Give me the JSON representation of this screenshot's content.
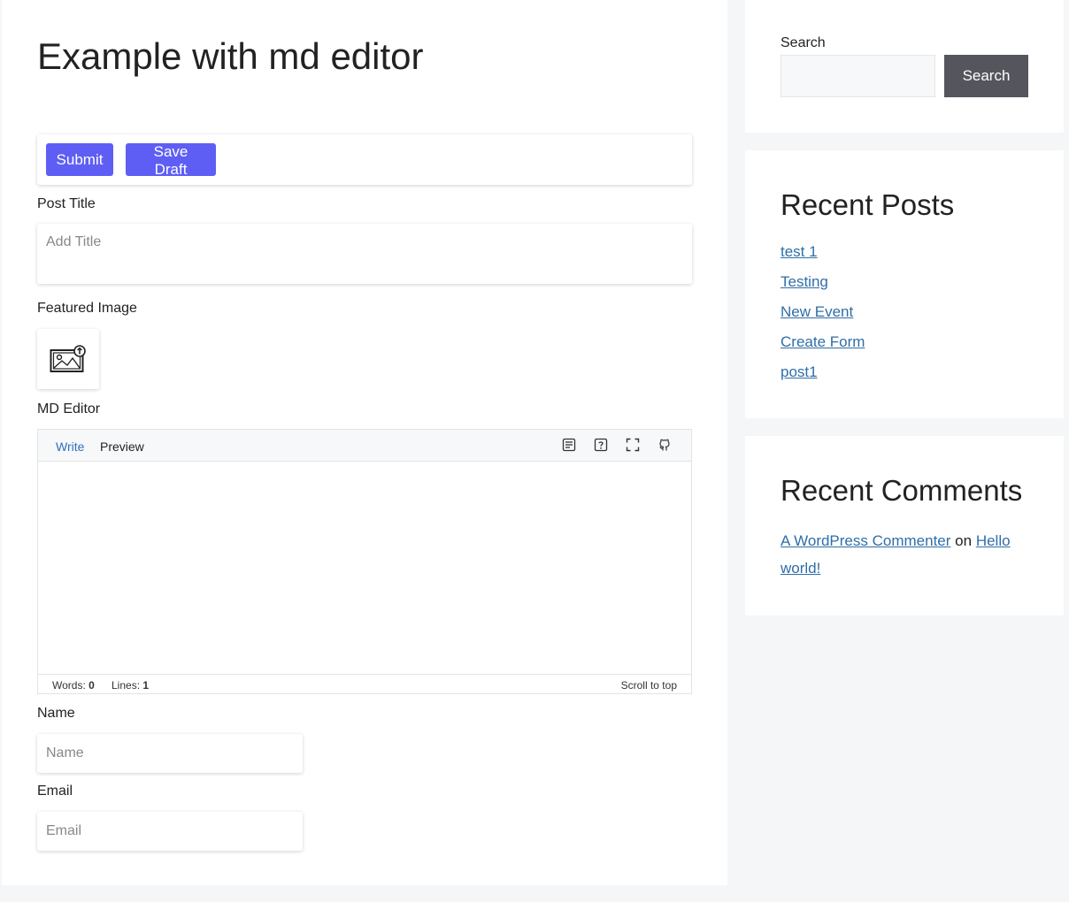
{
  "main": {
    "title": "Example with md editor",
    "toolbar": {
      "submit_label": "Submit",
      "save_draft_label": "Save Draft"
    },
    "post_title": {
      "label": "Post Title",
      "placeholder": "Add Title"
    },
    "featured_image": {
      "label": "Featured Image",
      "icon": "image-upload-icon"
    },
    "md_editor": {
      "label": "MD Editor",
      "tabs": [
        "Write",
        "Preview"
      ],
      "active_tab": "Write",
      "toolbar_icons": [
        "markdown-guide-icon",
        "help-icon",
        "fullscreen-icon",
        "github-icon"
      ],
      "words_label": "Words:",
      "words_value": "0",
      "lines_label": "Lines:",
      "lines_value": "1",
      "scroll_to_top": "Scroll to top"
    },
    "name": {
      "label": "Name",
      "placeholder": "Name"
    },
    "email": {
      "label": "Email",
      "placeholder": "Email"
    }
  },
  "sidebar": {
    "search": {
      "label": "Search",
      "button_label": "Search"
    },
    "recent_posts": {
      "title": "Recent Posts",
      "items": [
        "test 1",
        "Testing",
        "New Event",
        "Create Form",
        "post1"
      ]
    },
    "recent_comments": {
      "title": "Recent Comments",
      "author": "A WordPress Commenter",
      "on_text": "on",
      "post": "Hello world!"
    }
  },
  "colors": {
    "accent": "#5e5ef5",
    "link": "#2f6ea8",
    "search_button": "#55555e",
    "page_background": "#f5f6f8"
  }
}
